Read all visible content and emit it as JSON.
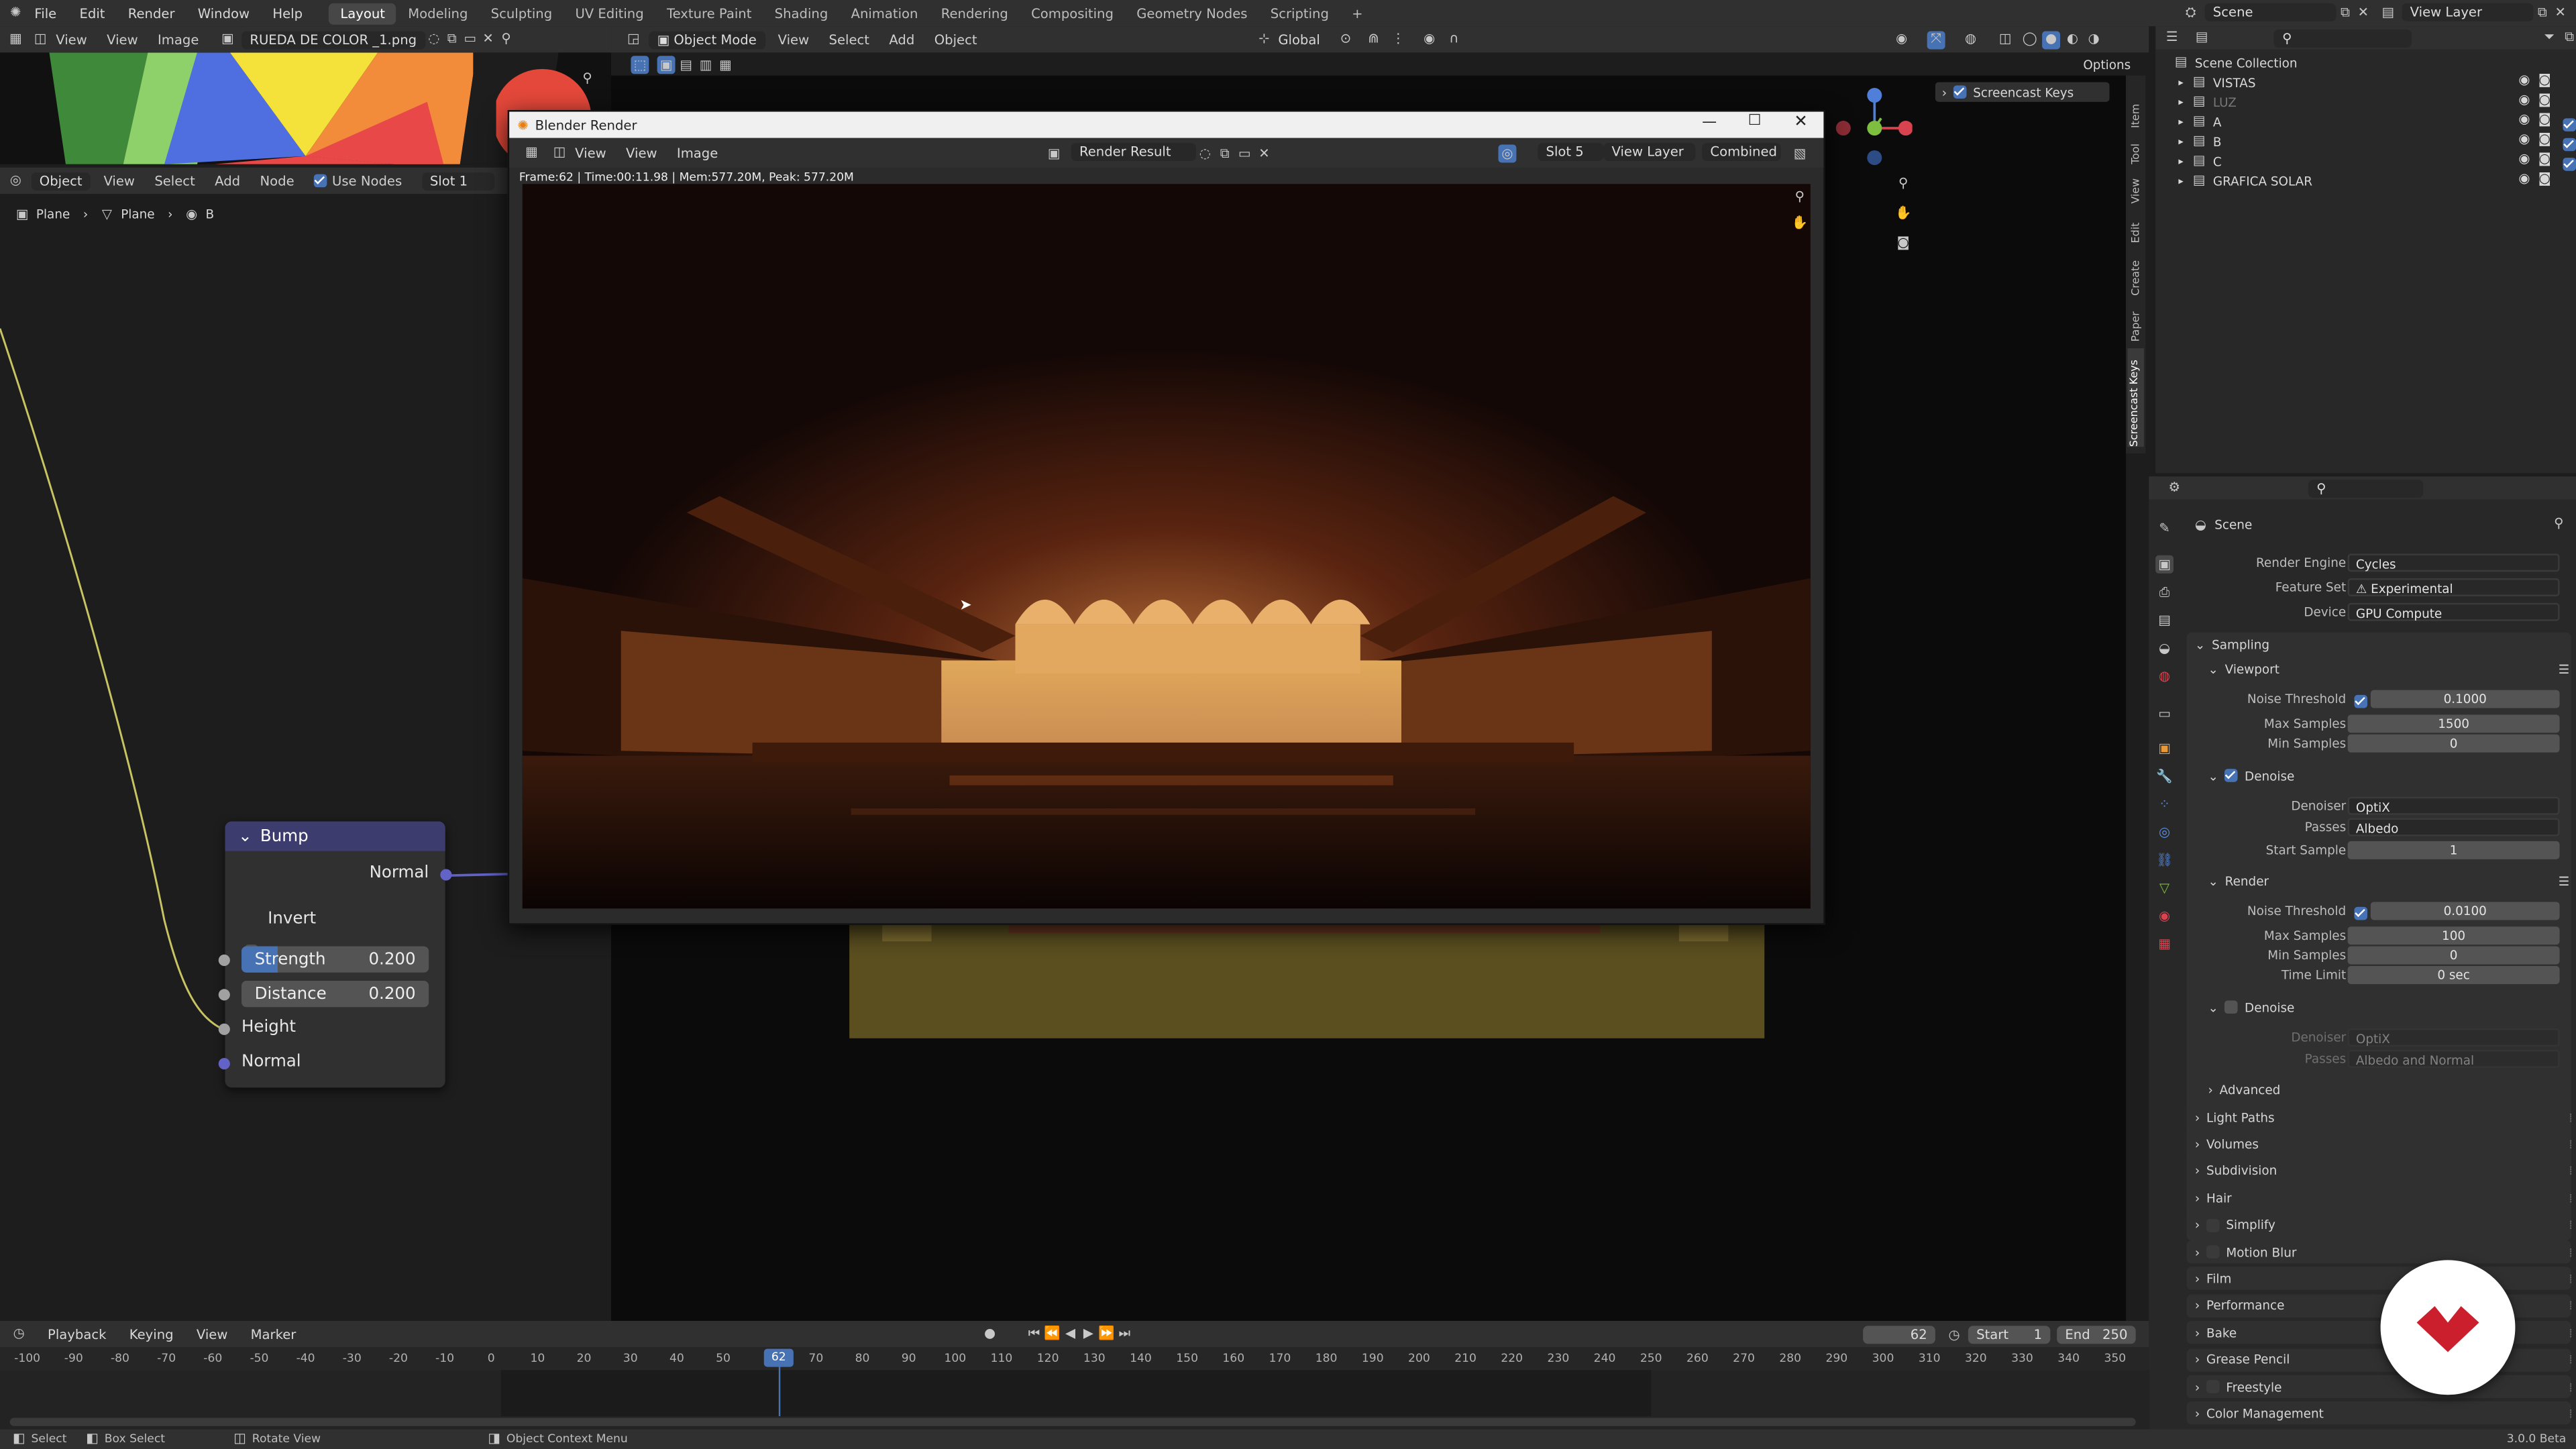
{
  "top_menu": [
    "File",
    "Edit",
    "Render",
    "Window",
    "Help"
  ],
  "workspaces": [
    "Layout",
    "Modeling",
    "Sculpting",
    "UV Editing",
    "Texture Paint",
    "Shading",
    "Animation",
    "Rendering",
    "Compositing",
    "Geometry Nodes",
    "Scripting"
  ],
  "active_workspace": "Layout",
  "scene_name": "Scene",
  "view_layer_name": "View Layer",
  "image_editor": {
    "menus": [
      "View",
      "Image"
    ],
    "image_name": "RUEDA DE COLOR _1.png"
  },
  "node_editor": {
    "menus": [
      "View",
      "Select",
      "Add",
      "Node"
    ],
    "object_dropdown": "Object",
    "use_nodes_label": "Use Nodes",
    "slot": "Slot 1",
    "breadcrumb": [
      "Plane",
      "Plane",
      "B"
    ],
    "bump_node": {
      "title": "Bump",
      "output_normal": "Normal",
      "invert_label": "Invert",
      "strength_label": "Strength",
      "strength_value": "0.200",
      "distance_label": "Distance",
      "distance_value": "0.200",
      "input_height": "Height",
      "input_normal": "Normal"
    }
  },
  "viewport": {
    "mode": "Object Mode",
    "menus": [
      "View",
      "Select",
      "Add",
      "Object"
    ],
    "orientation": "Global",
    "options_label": "Options",
    "screencast_keys_label": "Screencast Keys",
    "side_tabs": [
      "Item",
      "Tool",
      "View",
      "Edit",
      "Create",
      "Paper",
      "Screencast Keys"
    ]
  },
  "render_window": {
    "title": "Blender Render",
    "menus": [
      "View",
      "Image"
    ],
    "image_name": "Render Result",
    "slot": "Slot 5",
    "view_layer": "View Layer",
    "pass": "Combined",
    "stats": "Frame:62 | Time:00:11.98 | Mem:577.20M, Peak: 577.20M"
  },
  "outliner": {
    "root": "Scene Collection",
    "items": [
      {
        "name": "VISTAS",
        "dim": false
      },
      {
        "name": "LUZ",
        "dim": true
      },
      {
        "name": "A",
        "dim": false
      },
      {
        "name": "B",
        "dim": false
      },
      {
        "name": "C",
        "dim": false
      },
      {
        "name": "GRAFICA SOLAR",
        "dim": false
      }
    ]
  },
  "properties": {
    "context": "Scene",
    "render_engine_label": "Render Engine",
    "render_engine": "Cycles",
    "feature_set_label": "Feature Set",
    "feature_set": "Experimental",
    "device_label": "Device",
    "device": "GPU Compute",
    "sampling": "Sampling",
    "viewport": "Viewport",
    "noise_threshold_label": "Noise Threshold",
    "vp_noise_threshold": "0.1000",
    "max_samples_label": "Max Samples",
    "vp_max_samples": "1500",
    "min_samples_label": "Min Samples",
    "vp_min_samples": "0",
    "denoise": "Denoise",
    "denoiser_label": "Denoiser",
    "vp_denoiser": "OptiX",
    "passes_label": "Passes",
    "vp_passes": "Albedo",
    "start_sample_label": "Start Sample",
    "vp_start_sample": "1",
    "render": "Render",
    "r_noise_threshold": "0.0100",
    "r_max_samples": "100",
    "r_min_samples": "0",
    "time_limit_label": "Time Limit",
    "r_time_limit": "0 sec",
    "r_denoiser": "OptiX",
    "r_passes": "Albedo and Normal",
    "advanced": "Advanced",
    "sections": [
      "Light Paths",
      "Volumes",
      "Subdivision",
      "Hair",
      "Simplify",
      "Motion Blur",
      "Film",
      "Performance",
      "Bake",
      "Grease Pencil",
      "Freestyle",
      "Color Management"
    ]
  },
  "timeline": {
    "menus": [
      "Playback",
      "Keying",
      "View",
      "Marker"
    ],
    "current_frame": "62",
    "start_label": "Start",
    "start": "1",
    "end_label": "End",
    "end": "250",
    "ticks": [
      "-100",
      "-90",
      "-80",
      "-70",
      "-60",
      "-50",
      "-40",
      "-30",
      "-20",
      "-10",
      "0",
      "10",
      "20",
      "30",
      "40",
      "50",
      "62",
      "70",
      "80",
      "90",
      "100",
      "110",
      "120",
      "130",
      "140",
      "150",
      "160",
      "170",
      "180",
      "190",
      "200",
      "210",
      "220",
      "230",
      "240",
      "250",
      "260",
      "270",
      "280",
      "290",
      "300",
      "310",
      "320",
      "330",
      "340",
      "350"
    ]
  },
  "status_bar": {
    "select": "Select",
    "box_select": "Box Select",
    "rotate_view": "Rotate View",
    "context_menu": "Object Context Menu",
    "version": "3.0.0 Beta"
  },
  "colors": {
    "accent": "#4772b3",
    "node_header": "#3d3c6e",
    "logo": "#cc1f2d"
  }
}
